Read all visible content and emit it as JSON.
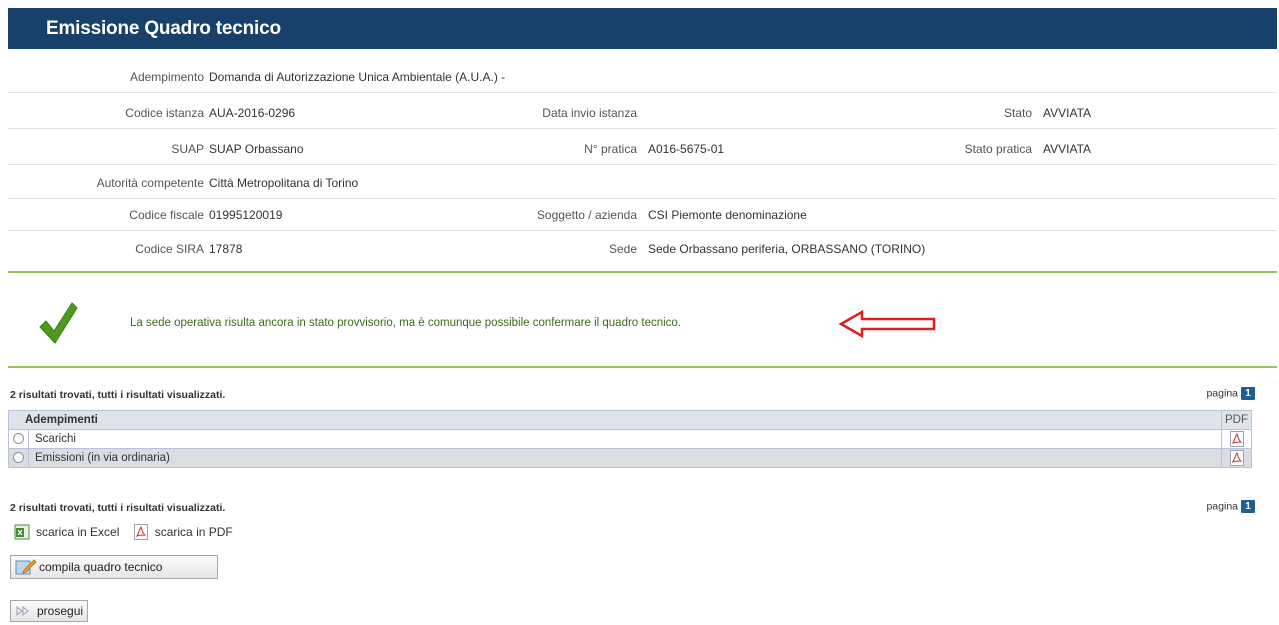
{
  "header": {
    "title": "Emissione Quadro tecnico"
  },
  "info": {
    "adempimento_label": "Adempimento",
    "adempimento_value": "Domanda di Autorizzazione Unica Ambientale (A.U.A.) -",
    "codice_istanza_label": "Codice istanza",
    "codice_istanza_value": "AUA-2016-0296",
    "data_invio_label": "Data invio istanza",
    "data_invio_value": "",
    "stato_label": "Stato",
    "stato_value": "AVVIATA",
    "suap_label": "SUAP",
    "suap_value": "SUAP Orbassano",
    "n_pratica_label": "N° pratica",
    "n_pratica_value": "A016-5675-01",
    "stato_pratica_label": "Stato pratica",
    "stato_pratica_value": "AVVIATA",
    "autorita_label": "Autorità competente",
    "autorita_value": "Città Metropolitana di Torino",
    "codice_fiscale_label": "Codice fiscale",
    "codice_fiscale_value": "01995120019",
    "soggetto_label": "Soggetto / azienda",
    "soggetto_value": "CSI Piemonte denominazione",
    "codice_sira_label": "Codice SIRA",
    "codice_sira_value": "17878",
    "sede_label": "Sede",
    "sede_value": "Sede Orbassano periferia, ORBASSANO (TORINO)"
  },
  "message": {
    "text": "La sede operativa risulta ancora in stato provvisorio, ma è comunque possibile confermare il quadro tecnico.",
    "icon": "checkmark-icon",
    "annotation_icon": "left-arrow-icon",
    "accent_color": "#9bc25a",
    "annotation_color": "#e01c1c"
  },
  "results": {
    "summary": "2 risultati trovati, tutti i risultati visualizzati.",
    "pagina_label": "pagina",
    "page_number": "1"
  },
  "table": {
    "columns": [
      "Adempimenti",
      "PDF"
    ],
    "rows": [
      {
        "name": "Scarichi",
        "selected": false
      },
      {
        "name": "Emissioni (in via ordinaria)",
        "selected": false
      }
    ]
  },
  "downloads": {
    "excel_label": "scarica in Excel",
    "pdf_label": "scarica in PDF"
  },
  "buttons": {
    "compila_label": "compila quadro tecnico",
    "prosegui_label": "prosegui"
  },
  "colors": {
    "header_bg": "#17406b",
    "table_header_bg": "#dde4ee",
    "page_badge": "#1f5f93"
  }
}
